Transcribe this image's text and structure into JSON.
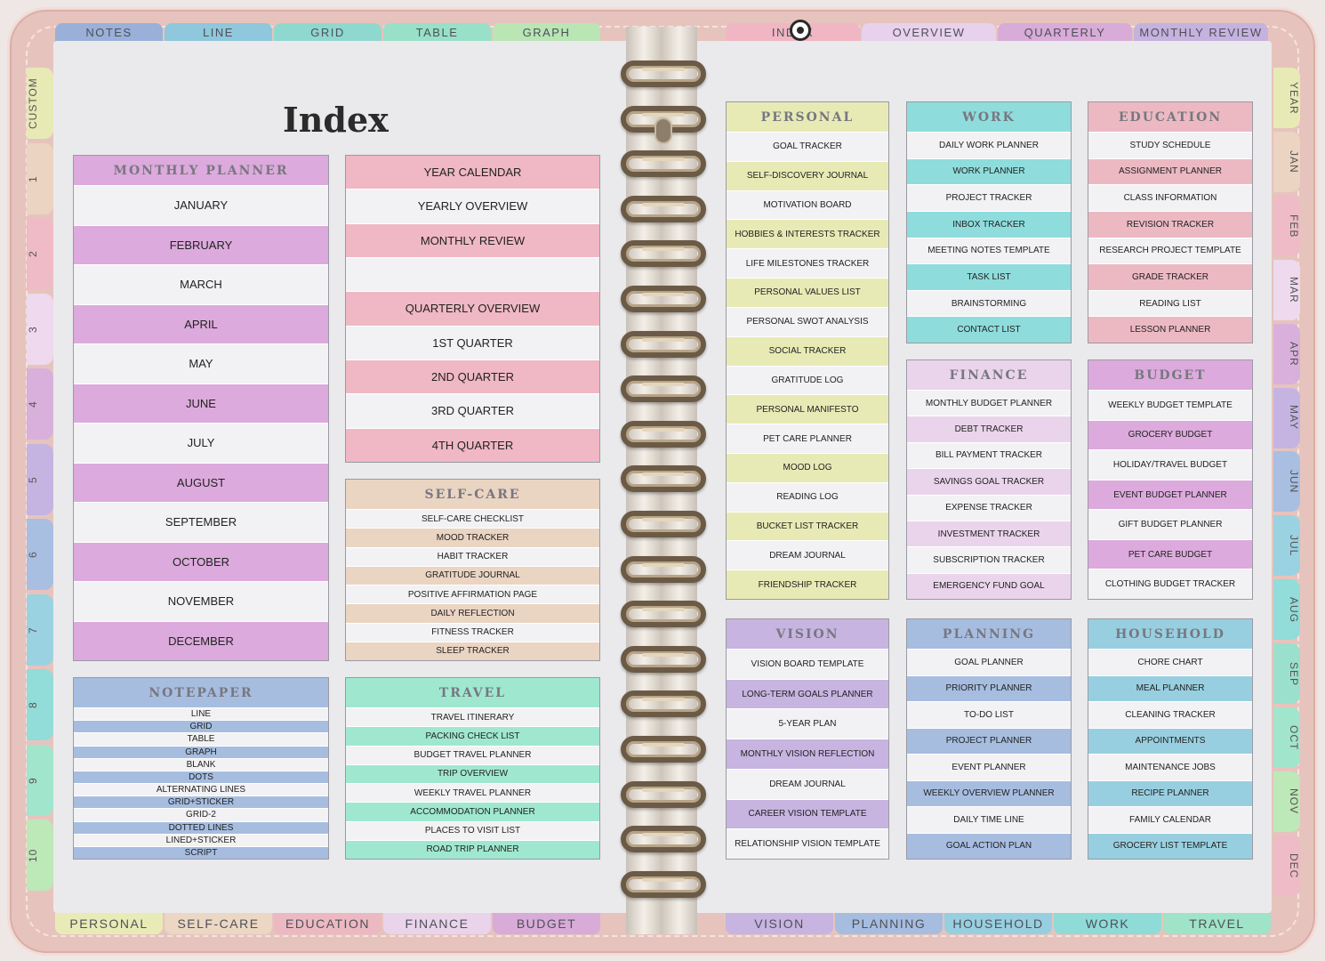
{
  "top_tabs_left": [
    {
      "label": "NOTES",
      "color": "#9ab0d9"
    },
    {
      "label": "LINE",
      "color": "#8fc7dc"
    },
    {
      "label": "GRID",
      "color": "#8fd8cf"
    },
    {
      "label": "TABLE",
      "color": "#98e0c8"
    },
    {
      "label": "GRAPH",
      "color": "#b9e6b4"
    }
  ],
  "top_tabs_right": [
    {
      "label": "INDEX",
      "color": "#f0b6c4"
    },
    {
      "label": "OVERVIEW",
      "color": "#e7d1ec"
    },
    {
      "label": "QUARTERLY",
      "color": "#d8abd9"
    },
    {
      "label": "MONTHLY REVIEW",
      "color": "#c5b2de"
    }
  ],
  "bottom_tabs_left": [
    {
      "label": "PERSONAL",
      "color": "#e9ebb7"
    },
    {
      "label": "SELF-CARE",
      "color": "#ebd7c4"
    },
    {
      "label": "EDUCATION",
      "color": "#ecb9c3"
    },
    {
      "label": "FINANCE",
      "color": "#ead4eb"
    },
    {
      "label": "BUDGET",
      "color": "#d8abd9"
    }
  ],
  "bottom_tabs_right": [
    {
      "label": "VISION",
      "color": "#c7b4e0"
    },
    {
      "label": "PLANNING",
      "color": "#a6bde0"
    },
    {
      "label": "HOUSEHOLD",
      "color": "#98cfe0"
    },
    {
      "label": "WORK",
      "color": "#8fdbd8"
    },
    {
      "label": "TRAVEL",
      "color": "#9fe3c8"
    }
  ],
  "left_side_tabs": [
    {
      "label": "CUSTOM",
      "color": "#e7eab5"
    },
    {
      "label": "1",
      "color": "#ebd4c2"
    },
    {
      "label": "2",
      "color": "#eebbc6"
    },
    {
      "label": "3",
      "color": "#eed9ee"
    },
    {
      "label": "4",
      "color": "#d9b0db"
    },
    {
      "label": "5",
      "color": "#c5b4e2"
    },
    {
      "label": "6",
      "color": "#a8bfe2"
    },
    {
      "label": "7",
      "color": "#9bd2e2"
    },
    {
      "label": "8",
      "color": "#92dcd9"
    },
    {
      "label": "9",
      "color": "#a1e5cc"
    },
    {
      "label": "10",
      "color": "#bde8b8"
    }
  ],
  "right_side_tabs": [
    {
      "label": "YEAR",
      "color": "#e7eab5"
    },
    {
      "label": "JAN",
      "color": "#ebd4c2"
    },
    {
      "label": "FEB",
      "color": "#eebbc6"
    },
    {
      "label": "MAR",
      "color": "#eed9ee"
    },
    {
      "label": "APR",
      "color": "#d9b0db"
    },
    {
      "label": "MAY",
      "color": "#c5b4e2"
    },
    {
      "label": "JUN",
      "color": "#a8bfe2"
    },
    {
      "label": "JUL",
      "color": "#9bd2e2"
    },
    {
      "label": "AUG",
      "color": "#92dcd9"
    },
    {
      "label": "SEP",
      "color": "#9be0cc"
    },
    {
      "label": "OCT",
      "color": "#a1e5cc"
    },
    {
      "label": "NOV",
      "color": "#bde8b8"
    },
    {
      "label": "DEC",
      "color": "#eebbc6"
    }
  ],
  "page_title": "Index",
  "boxes": [
    {
      "id": "monthly",
      "title": "MONTHLY PLANNER",
      "color": "#dcaadc",
      "items": [
        "JANUARY",
        "FEBRUARY",
        "MARCH",
        "APRIL",
        "MAY",
        "JUNE",
        "JULY",
        "AUGUST",
        "SEPTEMBER",
        "OCTOBER",
        "NOVEMBER",
        "DECEMBER"
      ]
    },
    {
      "id": "overview",
      "title": "",
      "color": "#efb8c4",
      "items": [
        "YEAR CALENDAR",
        "YEARLY OVERVIEW",
        "MONTHLY REVIEW",
        "",
        "QUARTERLY OVERVIEW",
        "1ST QUARTER",
        "2ND QUARTER",
        "3RD QUARTER",
        "4TH QUARTER"
      ]
    },
    {
      "id": "selfcare",
      "title": "SELF-CARE",
      "color": "#ead4c2",
      "items": [
        "SELF-CARE CHECKLIST",
        "MOOD TRACKER",
        "HABIT TRACKER",
        "GRATITUDE JOURNAL",
        "POSITIVE AFFIRMATION PAGE",
        "DAILY REFLECTION",
        "FITNESS TRACKER",
        "SLEEP TRACKER"
      ]
    },
    {
      "id": "notepaper",
      "title": "NOTEPAPER",
      "color": "#a6bde0",
      "items": [
        "LINE",
        "GRID",
        "TABLE",
        "GRAPH",
        "BLANK",
        "DOTS",
        "ALTERNATING LINES",
        "GRID+STICKER",
        "GRID-2",
        "DOTTED LINES",
        "LINED+STICKER",
        "SCRIPT"
      ]
    },
    {
      "id": "travel",
      "title": "TRAVEL",
      "color": "#9fe8cf",
      "items": [
        "TRAVEL ITINERARY",
        "PACKING CHECK LIST",
        "BUDGET TRAVEL PLANNER",
        "TRIP OVERVIEW",
        "WEEKLY TRAVEL PLANNER",
        "ACCOMMODATION PLANNER",
        "PLACES TO VISIT LIST",
        "ROAD TRIP PLANNER"
      ]
    },
    {
      "id": "personal",
      "title": "PERSONAL",
      "color": "#e8eab5",
      "items": [
        "GOAL TRACKER",
        "SELF-DISCOVERY JOURNAL",
        "MOTIVATION BOARD",
        "HOBBIES & INTERESTS TRACKER",
        "LIFE MILESTONES TRACKER",
        "PERSONAL VALUES LIST",
        "PERSONAL SWOT ANALYSIS",
        "SOCIAL TRACKER",
        "GRATITUDE LOG",
        "PERSONAL MANIFESTO",
        "PET CARE PLANNER",
        "MOOD LOG",
        "READING LOG",
        "BUCKET LIST TRACKER",
        "DREAM JOURNAL",
        "FRIENDSHIP TRACKER"
      ]
    },
    {
      "id": "work",
      "title": "WORK",
      "color": "#8fdcdc",
      "items": [
        "DAILY WORK PLANNER",
        "WORK PLANNER",
        "PROJECT TRACKER",
        "INBOX TRACKER",
        "MEETING NOTES TEMPLATE",
        "TASK LIST",
        "BRAINSTORMING",
        "CONTACT LIST"
      ]
    },
    {
      "id": "education",
      "title": "EDUCATION",
      "color": "#ecb9c3",
      "items": [
        "STUDY SCHEDULE",
        "ASSIGNMENT PLANNER",
        "CLASS INFORMATION",
        "REVISION TRACKER",
        "RESEARCH PROJECT TEMPLATE",
        "GRADE TRACKER",
        "READING LIST",
        "LESSON PLANNER"
      ]
    },
    {
      "id": "finance",
      "title": "FINANCE",
      "color": "#ead4eb",
      "items": [
        "MONTHLY BUDGET PLANNER",
        "DEBT TRACKER",
        "BILL PAYMENT TRACKER",
        "SAVINGS GOAL TRACKER",
        "EXPENSE TRACKER",
        "INVESTMENT TRACKER",
        "SUBSCRIPTION TRACKER",
        "EMERGENCY FUND GOAL"
      ]
    },
    {
      "id": "budget",
      "title": "BUDGET",
      "color": "#dcaadc",
      "items": [
        "WEEKLY BUDGET TEMPLATE",
        "GROCERY BUDGET",
        "HOLIDAY/TRAVEL BUDGET",
        "EVENT BUDGET PLANNER",
        "GIFT BUDGET PLANNER",
        "PET CARE BUDGET",
        "CLOTHING BUDGET TRACKER"
      ]
    },
    {
      "id": "vision",
      "title": "VISION",
      "color": "#c7b4e0",
      "items": [
        "VISION BOARD TEMPLATE",
        "LONG-TERM GOALS PLANNER",
        "5-YEAR PLAN",
        "MONTHLY VISION REFLECTION",
        "DREAM JOURNAL",
        "CAREER VISION TEMPLATE",
        "RELATIONSHIP VISION TEMPLATE"
      ]
    },
    {
      "id": "planning",
      "title": "PLANNING",
      "color": "#a6bde0",
      "items": [
        "GOAL PLANNER",
        "PRIORITY PLANNER",
        "TO-DO LIST",
        "PROJECT PLANNER",
        "EVENT PLANNER",
        "WEEKLY OVERVIEW PLANNER",
        "DAILY TIME LINE",
        "GOAL ACTION PLAN"
      ]
    },
    {
      "id": "household",
      "title": "HOUSEHOLD",
      "color": "#98cfe0",
      "items": [
        "CHORE CHART",
        "MEAL PLANNER",
        "CLEANING TRACKER",
        "APPOINTMENTS",
        "MAINTENANCE JOBS",
        "RECIPE PLANNER",
        "FAMILY CALENDAR",
        "GROCERY LIST TEMPLATE"
      ]
    }
  ]
}
